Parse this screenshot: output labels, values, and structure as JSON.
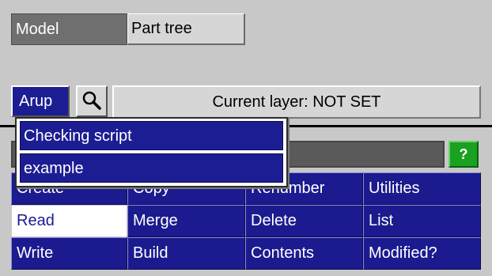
{
  "tabs": [
    {
      "label": "Model"
    },
    {
      "label": "Part tree"
    }
  ],
  "toolbar": {
    "menu_label": "Arup",
    "search_icon": "magnifier-icon",
    "current_layer": "Current layer: NOT SET"
  },
  "help_label": "?",
  "colors": {
    "button_blue": "#1b1b8f",
    "help_green": "#19a11f",
    "background": "#c8c8c8"
  },
  "grid": [
    [
      "Create",
      "Copy",
      "Renumber",
      "Utilities"
    ],
    [
      "Read",
      "Merge",
      "Delete",
      "List"
    ],
    [
      "Write",
      "Build",
      "Contents",
      "Modified?"
    ]
  ],
  "dropdown": {
    "items": [
      "Checking script",
      "example"
    ]
  }
}
